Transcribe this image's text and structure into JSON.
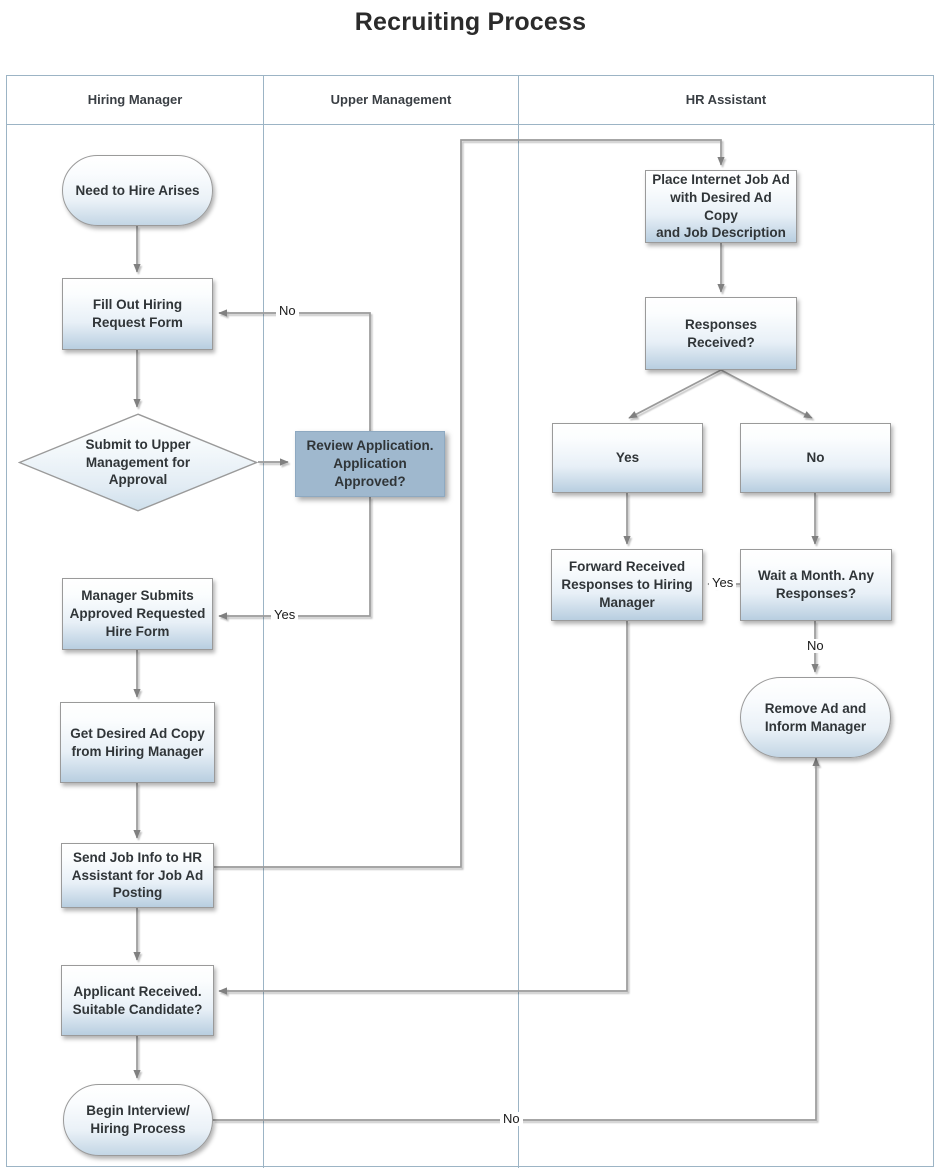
{
  "title": "Recruiting Process",
  "lanes": [
    {
      "label": "Hiring Manager"
    },
    {
      "label": "Upper Management"
    },
    {
      "label": "HR Assistant"
    }
  ],
  "nodes": {
    "need_to_hire": {
      "label": "Need to Hire Arises",
      "shape": "terminator"
    },
    "fill_out_form": {
      "label": "Fill Out Hiring\nRequest Form",
      "shape": "process"
    },
    "submit_approval": {
      "label": "Submit to Upper\nManagement for\nApproval",
      "shape": "decision"
    },
    "review_application": {
      "label": "Review Application.\nApplication\nApproved?",
      "shape": "process-solid"
    },
    "manager_submits": {
      "label": "Manager Submits\nApproved Requested\nHire Form",
      "shape": "process"
    },
    "get_ad_copy": {
      "label": "Get Desired Ad Copy\nfrom Hiring Manager",
      "shape": "process"
    },
    "send_job_info": {
      "label": "Send Job Info to HR\nAssistant for Job Ad\nPosting",
      "shape": "process"
    },
    "applicant_received": {
      "label": "Applicant Received.\nSuitable Candidate?",
      "shape": "process"
    },
    "begin_interview": {
      "label": "Begin Interview/\nHiring Process",
      "shape": "terminator"
    },
    "place_job_ad": {
      "label": "Place Internet Job Ad\nwith Desired Ad Copy\nand Job Description",
      "shape": "process"
    },
    "responses_received": {
      "label": "Responses\nReceived?",
      "shape": "process"
    },
    "responses_yes": {
      "label": "Yes",
      "shape": "process"
    },
    "responses_no": {
      "label": "No",
      "shape": "process"
    },
    "forward_responses": {
      "label": "Forward Received\nResponses to Hiring\nManager",
      "shape": "process"
    },
    "wait_a_month": {
      "label": "Wait a Month. Any\nResponses?",
      "shape": "process"
    },
    "remove_ad": {
      "label": "Remove Ad and\nInform Manager",
      "shape": "terminator"
    }
  },
  "edge_labels": {
    "rejected_no": "No",
    "approved_yes": "Yes",
    "wait_yes": "Yes",
    "wait_no": "No",
    "unsuitable_no": "No"
  },
  "colors": {
    "lane_border": "#9cb4c5",
    "connector": "#9a9a9a",
    "node_accent": "#b8cee0",
    "solid_node_fill": "#9fb8ce",
    "text": "#303538"
  }
}
